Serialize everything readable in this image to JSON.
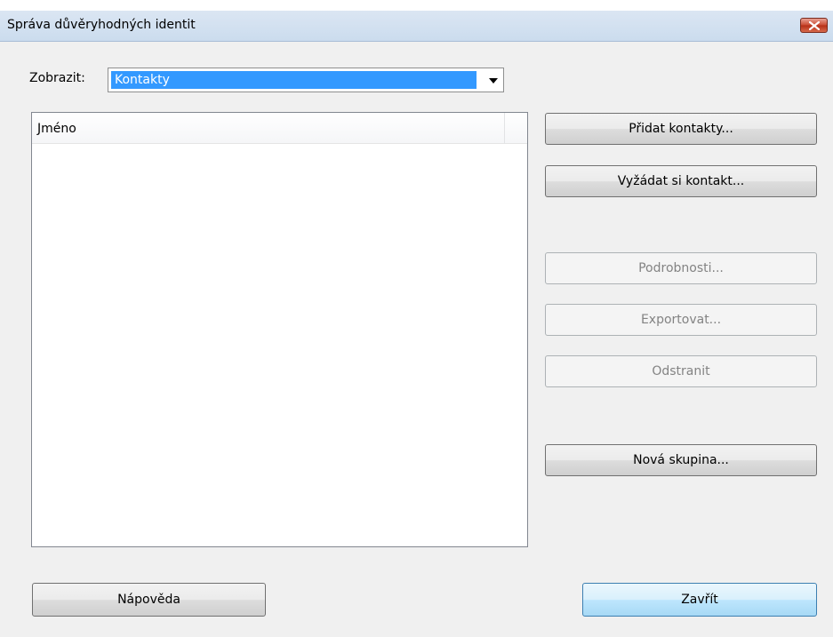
{
  "window": {
    "title": "Správa důvěryhodných identit"
  },
  "filter": {
    "label": "Zobrazit:",
    "selected": "Kontakty"
  },
  "list": {
    "columns": [
      "Jméno"
    ],
    "rows": []
  },
  "buttons": {
    "add_contacts": "Přidat kontakty...",
    "request_contact": "Vyžádat si kontakt...",
    "details": "Podrobnosti...",
    "export": "Exportovat...",
    "remove": "Odstranit",
    "new_group": "Nová skupina...",
    "help": "Nápověda",
    "close": "Zavřít"
  },
  "colors": {
    "selection": "#3399ff",
    "close_button": "#c9482f",
    "titlebar": "#cbdcee"
  }
}
